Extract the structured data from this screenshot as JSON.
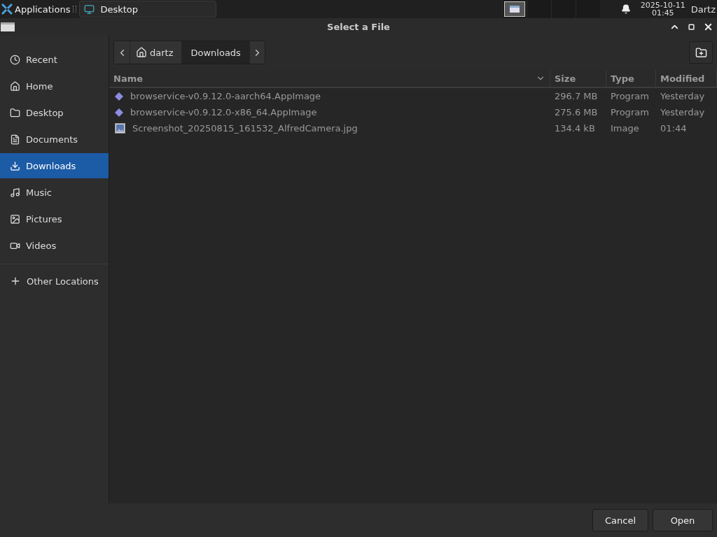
{
  "taskbar": {
    "menu_label": "Applications",
    "task": {
      "label": "Desktop",
      "selected": false
    },
    "workspaces": [
      {
        "selected": true
      },
      {
        "selected": false
      },
      {
        "selected": false
      },
      {
        "selected": false
      }
    ],
    "date": "2025-10-11",
    "time": "01:45",
    "user": "Dartz"
  },
  "window": {
    "title": "Select a File"
  },
  "sidebar": {
    "items": [
      {
        "label": "Recent",
        "selected": false
      },
      {
        "label": "Home",
        "selected": false
      },
      {
        "label": "Desktop",
        "selected": false
      },
      {
        "label": "Documents",
        "selected": false
      },
      {
        "label": "Downloads",
        "selected": true
      },
      {
        "label": "Music",
        "selected": false
      },
      {
        "label": "Pictures",
        "selected": false
      },
      {
        "label": "Videos",
        "selected": false
      }
    ],
    "other": {
      "label": "Other Locations"
    }
  },
  "path_bar": [
    {
      "label": "dartz",
      "selected": false
    },
    {
      "label": "Downloads",
      "selected": true
    }
  ],
  "table": {
    "columns": [
      "Name",
      "Size",
      "Type",
      "Modified"
    ],
    "rows": [
      {
        "kind": "program",
        "name": "browservice-v0.9.12.0-aarch64.AppImage",
        "size": "296.7 MB",
        "type": "Program",
        "modified": "Yesterday"
      },
      {
        "kind": "program",
        "name": "browservice-v0.9.12.0-x86_64.AppImage",
        "size": "275.6 MB",
        "type": "Program",
        "modified": "Yesterday"
      },
      {
        "kind": "image",
        "name": "Screenshot_20250815_161532_AlfredCamera.jpg",
        "size": "134.4 kB",
        "type": "Image",
        "modified": "01:44"
      }
    ]
  },
  "buttons": [
    "Cancel",
    "Open"
  ]
}
